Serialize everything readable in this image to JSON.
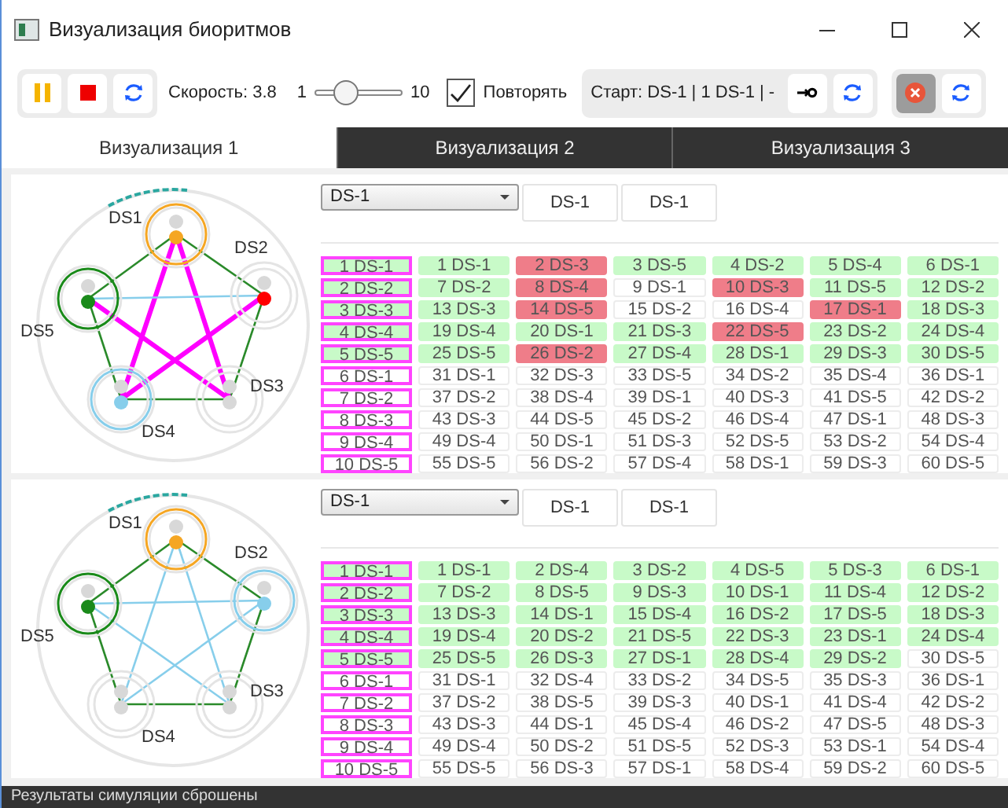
{
  "window": {
    "title": "Визуализация биоритмов"
  },
  "toolbar": {
    "speed_label": "Скорость: 3.8",
    "slider_min": "1",
    "slider_max": "10",
    "slider": {
      "level": 0.31
    },
    "repeat": {
      "label": "Повторять",
      "checked": true
    },
    "start_label": "Старт: DS-1 | 1 DS-1 | -",
    "clear_button": {
      "pressed": true
    }
  },
  "tabs": [
    {
      "label": "Визуализация 1",
      "selected": true
    },
    {
      "label": "Визуализация 2",
      "selected": false
    },
    {
      "label": "Визуализация 3",
      "selected": false
    }
  ],
  "panels": [
    {
      "select": "DS-1",
      "buttons": [
        "DS-1",
        "DS-1"
      ],
      "star": {
        "color": "#ff00ff"
      },
      "nodes": [
        {
          "label": "DS1",
          "kind": "ring",
          "color": "#f5a623"
        },
        {
          "label": "DS2",
          "kind": "dot",
          "color": "#ff0000"
        },
        {
          "label": "DS3",
          "kind": "plain"
        },
        {
          "label": "DS4",
          "kind": "ring",
          "color": "#87ceeb"
        },
        {
          "label": "DS5",
          "kind": "ring",
          "color": "#1a8a1a"
        }
      ],
      "rows": [
        {
          "label": "1 DS-1",
          "color": "#c8fac8",
          "cells": [
            {
              "text": "1 DS-1",
              "color": "#c8fac8"
            },
            {
              "text": "2 DS-3",
              "color": "#ef7d89"
            },
            {
              "text": "3 DS-5",
              "color": "#c8fac8"
            },
            {
              "text": "4 DS-2",
              "color": "#c8fac8"
            },
            {
              "text": "5 DS-4",
              "color": "#c8fac8"
            },
            {
              "text": "6 DS-1",
              "color": "#c8fac8"
            }
          ]
        },
        {
          "label": "2 DS-2",
          "color": "#c8fac8",
          "cells": [
            {
              "text": "7 DS-2",
              "color": "#c8fac8"
            },
            {
              "text": "8 DS-4",
              "color": "#ef7d89"
            },
            {
              "text": "9 DS-1"
            },
            {
              "text": "10 DS-3",
              "color": "#ef7d89"
            },
            {
              "text": "11 DS-5",
              "color": "#c8fac8"
            },
            {
              "text": "12 DS-2",
              "color": "#c8fac8"
            }
          ]
        },
        {
          "label": "3 DS-3",
          "color": "#c8fac8",
          "cells": [
            {
              "text": "13 DS-3",
              "color": "#c8fac8"
            },
            {
              "text": "14 DS-5",
              "color": "#ef7d89"
            },
            {
              "text": "15 DS-2"
            },
            {
              "text": "16 DS-4"
            },
            {
              "text": "17 DS-1",
              "color": "#ef7d89"
            },
            {
              "text": "18 DS-3",
              "color": "#c8fac8"
            }
          ]
        },
        {
          "label": "4 DS-4",
          "color": "#c8fac8",
          "cells": [
            {
              "text": "19 DS-4",
              "color": "#c8fac8"
            },
            {
              "text": "20 DS-1",
              "color": "#c8fac8"
            },
            {
              "text": "21 DS-3",
              "color": "#c8fac8"
            },
            {
              "text": "22 DS-5",
              "color": "#ef7d89"
            },
            {
              "text": "23 DS-2",
              "color": "#c8fac8"
            },
            {
              "text": "24 DS-4",
              "color": "#c8fac8"
            }
          ]
        },
        {
          "label": "5 DS-5",
          "color": "#c8fac8",
          "cells": [
            {
              "text": "25 DS-5",
              "color": "#c8fac8"
            },
            {
              "text": "26 DS-2",
              "color": "#ef7d89"
            },
            {
              "text": "27 DS-4",
              "color": "#c8fac8"
            },
            {
              "text": "28 DS-1",
              "color": "#c8fac8"
            },
            {
              "text": "29 DS-3",
              "color": "#c8fac8"
            },
            {
              "text": "30 DS-5",
              "color": "#c8fac8"
            }
          ]
        },
        {
          "label": "6 DS-1",
          "cells": [
            {
              "text": "31 DS-1"
            },
            {
              "text": "32 DS-3"
            },
            {
              "text": "33 DS-5"
            },
            {
              "text": "34 DS-2"
            },
            {
              "text": "35 DS-4"
            },
            {
              "text": "36 DS-1"
            }
          ]
        },
        {
          "label": "7 DS-2",
          "cells": [
            {
              "text": "37 DS-2"
            },
            {
              "text": "38 DS-4"
            },
            {
              "text": "39 DS-1"
            },
            {
              "text": "40 DS-3"
            },
            {
              "text": "41 DS-5"
            },
            {
              "text": "42 DS-2"
            }
          ]
        },
        {
          "label": "8 DS-3",
          "cells": [
            {
              "text": "43 DS-3"
            },
            {
              "text": "44 DS-5"
            },
            {
              "text": "45 DS-2"
            },
            {
              "text": "46 DS-4"
            },
            {
              "text": "47 DS-1"
            },
            {
              "text": "48 DS-3"
            }
          ]
        },
        {
          "label": "9 DS-4",
          "cells": [
            {
              "text": "49 DS-4"
            },
            {
              "text": "50 DS-1"
            },
            {
              "text": "51 DS-3"
            },
            {
              "text": "52 DS-5"
            },
            {
              "text": "53 DS-2"
            },
            {
              "text": "54 DS-4"
            }
          ]
        },
        {
          "label": "10 DS-5",
          "cells": [
            {
              "text": "55 DS-5"
            },
            {
              "text": "56 DS-2"
            },
            {
              "text": "57 DS-4"
            },
            {
              "text": "58 DS-1"
            },
            {
              "text": "59 DS-3"
            },
            {
              "text": "60 DS-5"
            }
          ]
        }
      ]
    },
    {
      "select": "DS-1",
      "buttons": [
        "DS-1",
        "DS-1"
      ],
      "star": {
        "color": "#87ceeb"
      },
      "nodes": [
        {
          "label": "DS1",
          "kind": "ring",
          "color": "#f5a623"
        },
        {
          "label": "DS2",
          "kind": "ring",
          "color": "#87ceeb"
        },
        {
          "label": "DS3",
          "kind": "plain"
        },
        {
          "label": "DS4",
          "kind": "plain"
        },
        {
          "label": "DS5",
          "kind": "ring",
          "color": "#1a8a1a"
        }
      ],
      "rows": [
        {
          "label": "1 DS-1",
          "color": "#c8fac8",
          "cells": [
            {
              "text": "1 DS-1",
              "color": "#c8fac8"
            },
            {
              "text": "2 DS-4",
              "color": "#c8fac8"
            },
            {
              "text": "3 DS-2",
              "color": "#c8fac8"
            },
            {
              "text": "4 DS-5",
              "color": "#c8fac8"
            },
            {
              "text": "5 DS-3",
              "color": "#c8fac8"
            },
            {
              "text": "6 DS-1",
              "color": "#c8fac8"
            }
          ]
        },
        {
          "label": "2 DS-2",
          "color": "#c8fac8",
          "cells": [
            {
              "text": "7 DS-2",
              "color": "#c8fac8"
            },
            {
              "text": "8 DS-5",
              "color": "#c8fac8"
            },
            {
              "text": "9 DS-3",
              "color": "#c8fac8"
            },
            {
              "text": "10 DS-1",
              "color": "#c8fac8"
            },
            {
              "text": "11 DS-4",
              "color": "#c8fac8"
            },
            {
              "text": "12 DS-2",
              "color": "#c8fac8"
            }
          ]
        },
        {
          "label": "3 DS-3",
          "color": "#c8fac8",
          "cells": [
            {
              "text": "13 DS-3",
              "color": "#c8fac8"
            },
            {
              "text": "14 DS-1",
              "color": "#c8fac8"
            },
            {
              "text": "15 DS-4",
              "color": "#c8fac8"
            },
            {
              "text": "16 DS-2",
              "color": "#c8fac8"
            },
            {
              "text": "17 DS-5",
              "color": "#c8fac8"
            },
            {
              "text": "18 DS-3",
              "color": "#c8fac8"
            }
          ]
        },
        {
          "label": "4 DS-4",
          "color": "#c8fac8",
          "cells": [
            {
              "text": "19 DS-4",
              "color": "#c8fac8"
            },
            {
              "text": "20 DS-2",
              "color": "#c8fac8"
            },
            {
              "text": "21 DS-5",
              "color": "#c8fac8"
            },
            {
              "text": "22 DS-3",
              "color": "#c8fac8"
            },
            {
              "text": "23 DS-1",
              "color": "#c8fac8"
            },
            {
              "text": "24 DS-4",
              "color": "#c8fac8"
            }
          ]
        },
        {
          "label": "5 DS-5",
          "color": "#c8fac8",
          "cells": [
            {
              "text": "25 DS-5",
              "color": "#c8fac8"
            },
            {
              "text": "26 DS-3",
              "color": "#c8fac8"
            },
            {
              "text": "27 DS-1",
              "color": "#c8fac8"
            },
            {
              "text": "28 DS-4",
              "color": "#c8fac8"
            },
            {
              "text": "29 DS-2",
              "color": "#c8fac8"
            },
            {
              "text": "30 DS-5"
            }
          ]
        },
        {
          "label": "6 DS-1",
          "cells": [
            {
              "text": "31 DS-1"
            },
            {
              "text": "32 DS-4"
            },
            {
              "text": "33 DS-2"
            },
            {
              "text": "34 DS-5"
            },
            {
              "text": "35 DS-3"
            },
            {
              "text": "36 DS-1"
            }
          ]
        },
        {
          "label": "7 DS-2",
          "cells": [
            {
              "text": "37 DS-2"
            },
            {
              "text": "38 DS-5"
            },
            {
              "text": "39 DS-3"
            },
            {
              "text": "40 DS-1"
            },
            {
              "text": "41 DS-4"
            },
            {
              "text": "42 DS-2"
            }
          ]
        },
        {
          "label": "8 DS-3",
          "cells": [
            {
              "text": "43 DS-3"
            },
            {
              "text": "44 DS-1"
            },
            {
              "text": "45 DS-4"
            },
            {
              "text": "46 DS-2"
            },
            {
              "text": "47 DS-5"
            },
            {
              "text": "48 DS-3"
            }
          ]
        },
        {
          "label": "9 DS-4",
          "cells": [
            {
              "text": "49 DS-4"
            },
            {
              "text": "50 DS-2"
            },
            {
              "text": "51 DS-5"
            },
            {
              "text": "52 DS-3"
            },
            {
              "text": "53 DS-1"
            },
            {
              "text": "54 DS-4"
            }
          ]
        },
        {
          "label": "10 DS-5",
          "cells": [
            {
              "text": "55 DS-5"
            },
            {
              "text": "56 DS-3"
            },
            {
              "text": "57 DS-1"
            },
            {
              "text": "58 DS-4"
            },
            {
              "text": "59 DS-2"
            },
            {
              "text": "60 DS-5"
            }
          ]
        }
      ]
    }
  ],
  "status_bar": "Результаты симуляции сброшены"
}
